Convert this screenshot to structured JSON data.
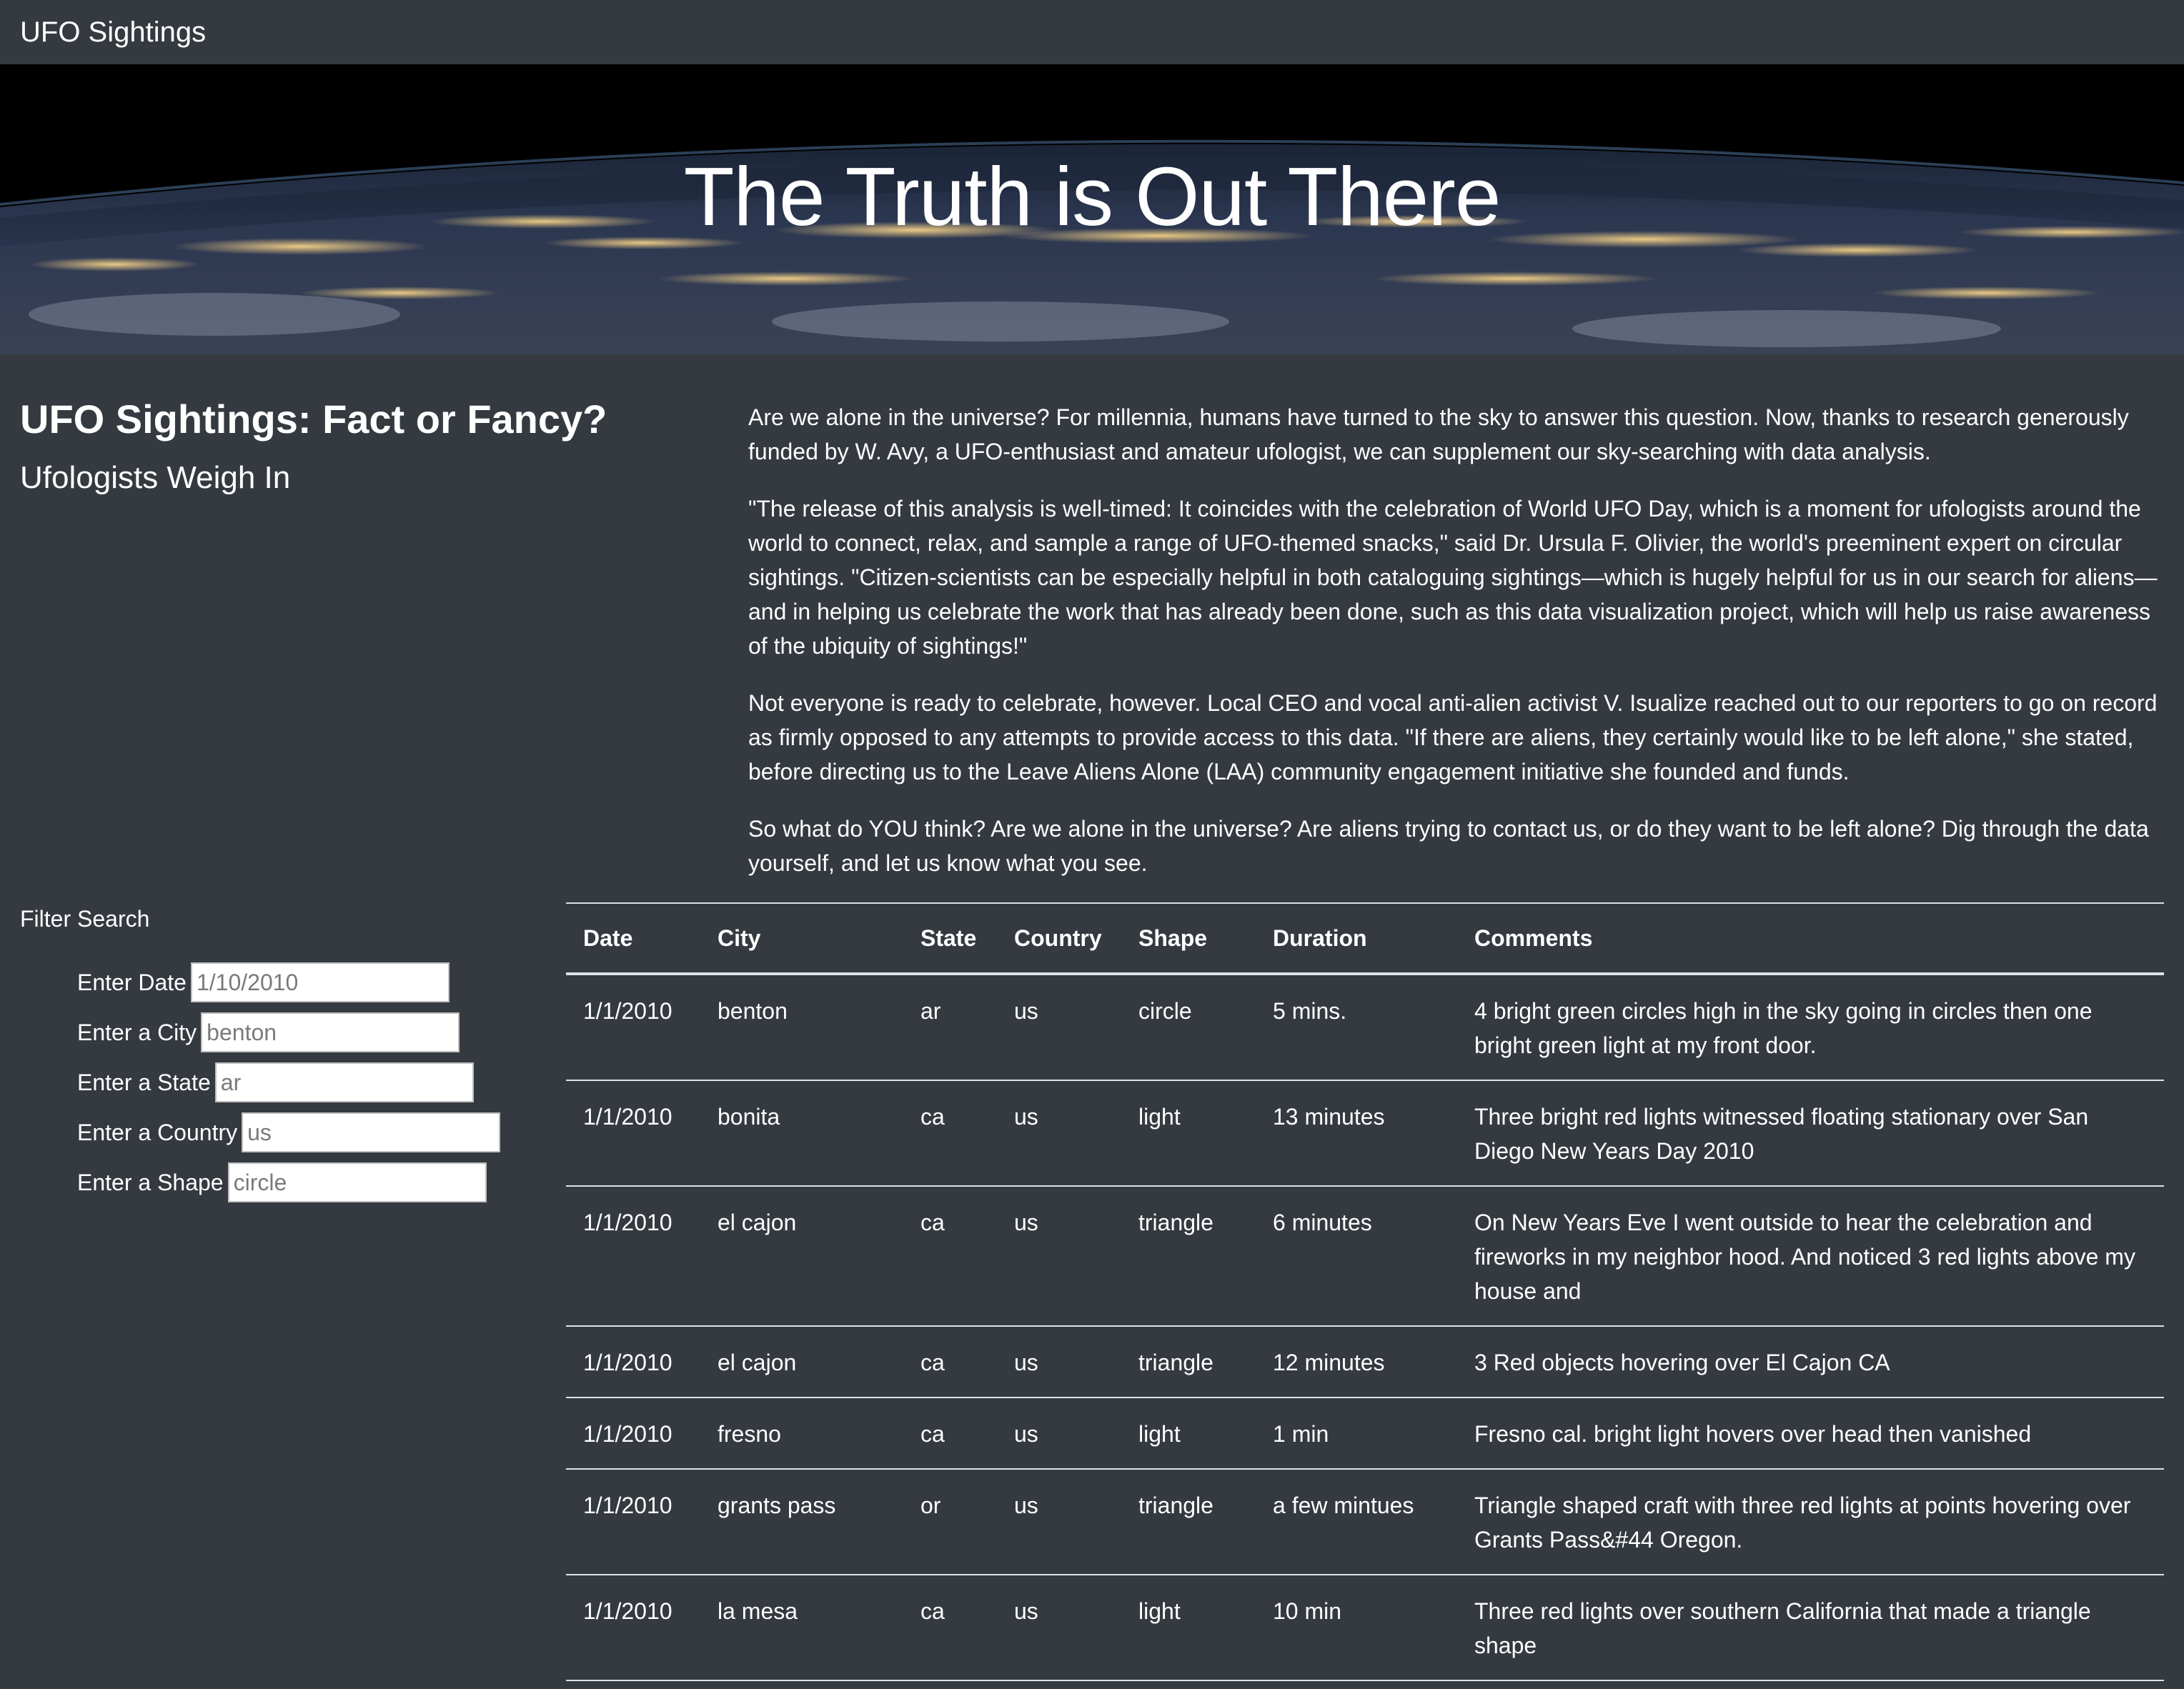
{
  "navbar": {
    "brand": "UFO Sightings"
  },
  "hero": {
    "title": "The Truth is Out There"
  },
  "intro": {
    "title": "UFO Sightings: Fact or Fancy?",
    "subtitle": "Ufologists Weigh In"
  },
  "article": {
    "paragraphs": [
      "Are we alone in the universe? For millennia, humans have turned to the sky to answer this question. Now, thanks to research generously funded by W. Avy, a UFO-enthusiast and amateur ufologist, we can supplement our sky-searching with data analysis.",
      "\"The release of this analysis is well-timed: It coincides with the celebration of World UFO Day, which is a moment for ufologists around the world to connect, relax, and sample a range of UFO-themed snacks,\" said Dr. Ursula F. Olivier, the world's preeminent expert on circular sightings. \"Citizen-scientists can be especially helpful in both cataloguing sightings—which is hugely helpful for us in our search for aliens—and in helping us celebrate the work that has already been done, such as this data visualization project, which will help us raise awareness of the ubiquity of sightings!\"",
      "Not everyone is ready to celebrate, however. Local CEO and vocal anti-alien activist V. Isualize reached out to our reporters to go on record as firmly opposed to any attempts to provide access to this data. \"If there are aliens, they certainly would like to be left alone,\" she stated, before directing us to the Leave Aliens Alone (LAA) community engagement initiative she founded and funds.",
      "So what do YOU think? Are we alone in the universe? Are aliens trying to contact us, or do they want to be left alone? Dig through the data yourself, and let us know what you see."
    ]
  },
  "filter": {
    "heading": "Filter Search",
    "fields": [
      {
        "label": "Enter Date",
        "placeholder": "1/10/2010"
      },
      {
        "label": "Enter a City",
        "placeholder": "benton"
      },
      {
        "label": "Enter a State",
        "placeholder": "ar"
      },
      {
        "label": "Enter a Country",
        "placeholder": "us"
      },
      {
        "label": "Enter a Shape",
        "placeholder": "circle"
      }
    ]
  },
  "table": {
    "headers": [
      "Date",
      "City",
      "State",
      "Country",
      "Shape",
      "Duration",
      "Comments"
    ],
    "rows": [
      [
        "1/1/2010",
        "benton",
        "ar",
        "us",
        "circle",
        "5 mins.",
        "4 bright green circles high in the sky going in circles then one bright green light at my front door."
      ],
      [
        "1/1/2010",
        "bonita",
        "ca",
        "us",
        "light",
        "13 minutes",
        "Three bright red lights witnessed floating stationary over San Diego New Years Day 2010"
      ],
      [
        "1/1/2010",
        "el cajon",
        "ca",
        "us",
        "triangle",
        "6 minutes",
        "On New Years Eve I went outside to hear the celebration and fireworks in my neighbor hood. And noticed 3 red lights above my house and"
      ],
      [
        "1/1/2010",
        "el cajon",
        "ca",
        "us",
        "triangle",
        "12 minutes",
        "3 Red objects hovering over El Cajon CA"
      ],
      [
        "1/1/2010",
        "fresno",
        "ca",
        "us",
        "light",
        "1 min",
        "Fresno cal. bright light hovers over head then vanished"
      ],
      [
        "1/1/2010",
        "grants pass",
        "or",
        "us",
        "triangle",
        "a few mintues",
        "Triangle shaped craft with three red lights at points hovering over Grants Pass&#44 Oregon."
      ],
      [
        "1/1/2010",
        "la mesa",
        "ca",
        "us",
        "light",
        "10 min",
        "Three red lights over southern California that made a triangle shape"
      ]
    ]
  }
}
